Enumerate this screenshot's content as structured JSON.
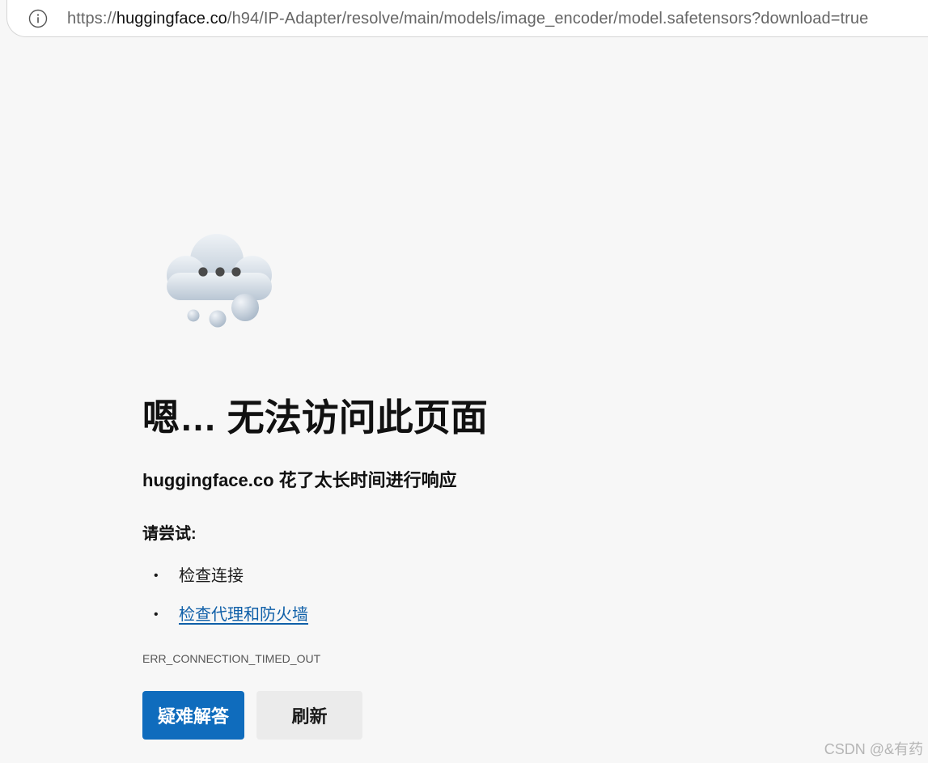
{
  "address_bar": {
    "url_prefix": "https://",
    "url_host": "huggingface.co",
    "url_path": "/h94/IP-Adapter/resolve/main/models/image_encoder/model.safetensors?download=true",
    "icon": "info-icon"
  },
  "illustration": {
    "icon": "cloud-icon"
  },
  "error": {
    "title": "嗯… 无法访问此页面",
    "subtitle": "huggingface.co 花了太长时间进行响应",
    "try_label": "请尝试:",
    "suggestions": [
      {
        "label": "检查连接",
        "is_link": false
      },
      {
        "label": "检查代理和防火墙",
        "is_link": true
      }
    ],
    "code": "ERR_CONNECTION_TIMED_OUT"
  },
  "buttons": {
    "troubleshoot_label": "疑难解答",
    "refresh_label": "刷新"
  },
  "watermark": "CSDN @&有药",
  "colors": {
    "primary_button": "#0f6cbd",
    "link": "#0f5fa8",
    "page_background": "#f7f7f7"
  }
}
